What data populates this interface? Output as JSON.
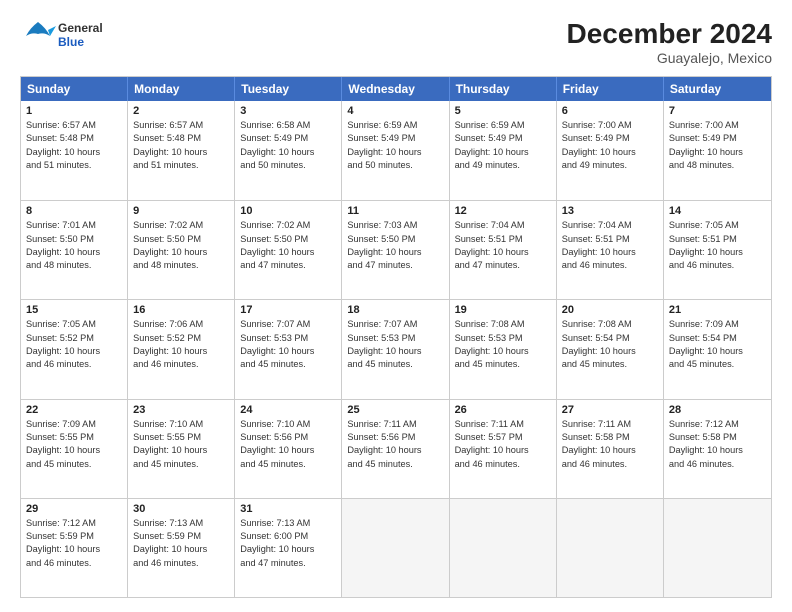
{
  "logo": {
    "line1": "General",
    "line2": "Blue"
  },
  "title": "December 2024",
  "subtitle": "Guayalejo, Mexico",
  "days": [
    "Sunday",
    "Monday",
    "Tuesday",
    "Wednesday",
    "Thursday",
    "Friday",
    "Saturday"
  ],
  "weeks": [
    [
      {
        "day": "1",
        "rise": "6:57 AM",
        "set": "5:48 PM",
        "hours": "10 hours and 51 minutes."
      },
      {
        "day": "2",
        "rise": "6:57 AM",
        "set": "5:48 PM",
        "hours": "10 hours and 51 minutes."
      },
      {
        "day": "3",
        "rise": "6:58 AM",
        "set": "5:49 PM",
        "hours": "10 hours and 50 minutes."
      },
      {
        "day": "4",
        "rise": "6:59 AM",
        "set": "5:49 PM",
        "hours": "10 hours and 50 minutes."
      },
      {
        "day": "5",
        "rise": "6:59 AM",
        "set": "5:49 PM",
        "hours": "10 hours and 49 minutes."
      },
      {
        "day": "6",
        "rise": "7:00 AM",
        "set": "5:49 PM",
        "hours": "10 hours and 49 minutes."
      },
      {
        "day": "7",
        "rise": "7:00 AM",
        "set": "5:49 PM",
        "hours": "10 hours and 48 minutes."
      }
    ],
    [
      {
        "day": "8",
        "rise": "7:01 AM",
        "set": "5:50 PM",
        "hours": "10 hours and 48 minutes."
      },
      {
        "day": "9",
        "rise": "7:02 AM",
        "set": "5:50 PM",
        "hours": "10 hours and 48 minutes."
      },
      {
        "day": "10",
        "rise": "7:02 AM",
        "set": "5:50 PM",
        "hours": "10 hours and 47 minutes."
      },
      {
        "day": "11",
        "rise": "7:03 AM",
        "set": "5:50 PM",
        "hours": "10 hours and 47 minutes."
      },
      {
        "day": "12",
        "rise": "7:04 AM",
        "set": "5:51 PM",
        "hours": "10 hours and 47 minutes."
      },
      {
        "day": "13",
        "rise": "7:04 AM",
        "set": "5:51 PM",
        "hours": "10 hours and 46 minutes."
      },
      {
        "day": "14",
        "rise": "7:05 AM",
        "set": "5:51 PM",
        "hours": "10 hours and 46 minutes."
      }
    ],
    [
      {
        "day": "15",
        "rise": "7:05 AM",
        "set": "5:52 PM",
        "hours": "10 hours and 46 minutes."
      },
      {
        "day": "16",
        "rise": "7:06 AM",
        "set": "5:52 PM",
        "hours": "10 hours and 46 minutes."
      },
      {
        "day": "17",
        "rise": "7:07 AM",
        "set": "5:53 PM",
        "hours": "10 hours and 45 minutes."
      },
      {
        "day": "18",
        "rise": "7:07 AM",
        "set": "5:53 PM",
        "hours": "10 hours and 45 minutes."
      },
      {
        "day": "19",
        "rise": "7:08 AM",
        "set": "5:53 PM",
        "hours": "10 hours and 45 minutes."
      },
      {
        "day": "20",
        "rise": "7:08 AM",
        "set": "5:54 PM",
        "hours": "10 hours and 45 minutes."
      },
      {
        "day": "21",
        "rise": "7:09 AM",
        "set": "5:54 PM",
        "hours": "10 hours and 45 minutes."
      }
    ],
    [
      {
        "day": "22",
        "rise": "7:09 AM",
        "set": "5:55 PM",
        "hours": "10 hours and 45 minutes."
      },
      {
        "day": "23",
        "rise": "7:10 AM",
        "set": "5:55 PM",
        "hours": "10 hours and 45 minutes."
      },
      {
        "day": "24",
        "rise": "7:10 AM",
        "set": "5:56 PM",
        "hours": "10 hours and 45 minutes."
      },
      {
        "day": "25",
        "rise": "7:11 AM",
        "set": "5:56 PM",
        "hours": "10 hours and 45 minutes."
      },
      {
        "day": "26",
        "rise": "7:11 AM",
        "set": "5:57 PM",
        "hours": "10 hours and 46 minutes."
      },
      {
        "day": "27",
        "rise": "7:11 AM",
        "set": "5:58 PM",
        "hours": "10 hours and 46 minutes."
      },
      {
        "day": "28",
        "rise": "7:12 AM",
        "set": "5:58 PM",
        "hours": "10 hours and 46 minutes."
      }
    ],
    [
      {
        "day": "29",
        "rise": "7:12 AM",
        "set": "5:59 PM",
        "hours": "10 hours and 46 minutes."
      },
      {
        "day": "30",
        "rise": "7:13 AM",
        "set": "5:59 PM",
        "hours": "10 hours and 46 minutes."
      },
      {
        "day": "31",
        "rise": "7:13 AM",
        "set": "6:00 PM",
        "hours": "10 hours and 47 minutes."
      },
      null,
      null,
      null,
      null
    ]
  ],
  "labels": {
    "sunrise": "Sunrise:",
    "sunset": "Sunset:",
    "daylight": "Daylight:"
  }
}
